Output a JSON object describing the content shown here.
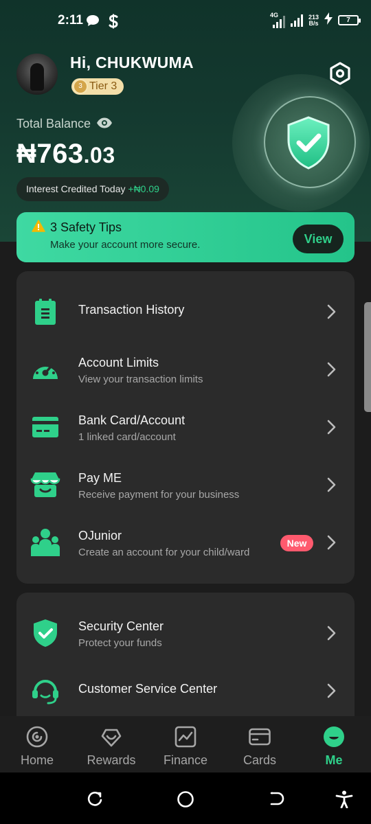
{
  "status_bar": {
    "time": "2:11",
    "network_type": "4G",
    "speed_value": "213",
    "speed_unit": "B/s",
    "battery": "7",
    "icons": [
      "chat-bubble-icon",
      "s-app-icon",
      "signal-icon",
      "wifi-signal-icon",
      "charging-icon",
      "battery-icon"
    ]
  },
  "profile": {
    "greeting": "Hi, CHUKWUMA",
    "tier": "Tier 3",
    "tier_medal": "3"
  },
  "balance": {
    "label": "Total Balance",
    "currency_symbol": "₦",
    "whole": "763",
    "decimal": ".03",
    "interest_label": "Interest Credited Today ",
    "interest_amount": "+₦0.09"
  },
  "safety_tips": {
    "title": "3 Safety Tips",
    "subtitle": "Make your account more secure.",
    "button": "View"
  },
  "menu": {
    "items": [
      {
        "title": "Transaction History",
        "subtitle": "",
        "icon": "document-list-icon"
      },
      {
        "title": "Account Limits",
        "subtitle": "View your transaction limits",
        "icon": "speedometer-icon"
      },
      {
        "title": "Bank Card/Account",
        "subtitle": "1 linked card/account",
        "icon": "bank-card-icon"
      },
      {
        "title": "Pay ME",
        "subtitle": "Receive payment for your business",
        "icon": "shop-icon"
      },
      {
        "title": "OJunior",
        "subtitle": "Create an account for your child/ward",
        "icon": "family-icon",
        "badge": "New"
      }
    ],
    "items2": [
      {
        "title": "Security Center",
        "subtitle": "Protect your funds",
        "icon": "shield-check-icon"
      },
      {
        "title": "Customer Service Center",
        "subtitle": "",
        "icon": "headset-icon"
      }
    ]
  },
  "tabs": [
    {
      "label": "Home",
      "icon": "home-icon",
      "active": false
    },
    {
      "label": "Rewards",
      "icon": "rewards-icon",
      "active": false
    },
    {
      "label": "Finance",
      "icon": "finance-chart-icon",
      "active": false
    },
    {
      "label": "Cards",
      "icon": "card-icon",
      "active": false
    },
    {
      "label": "Me",
      "icon": "me-face-icon",
      "active": true
    }
  ],
  "colors": {
    "accent": "#2fd08a",
    "header_bg": "#14392f",
    "card_bg": "#2b2b2b",
    "badge_new": "#ff5a6e",
    "tier_badge": "#f3dea8"
  }
}
